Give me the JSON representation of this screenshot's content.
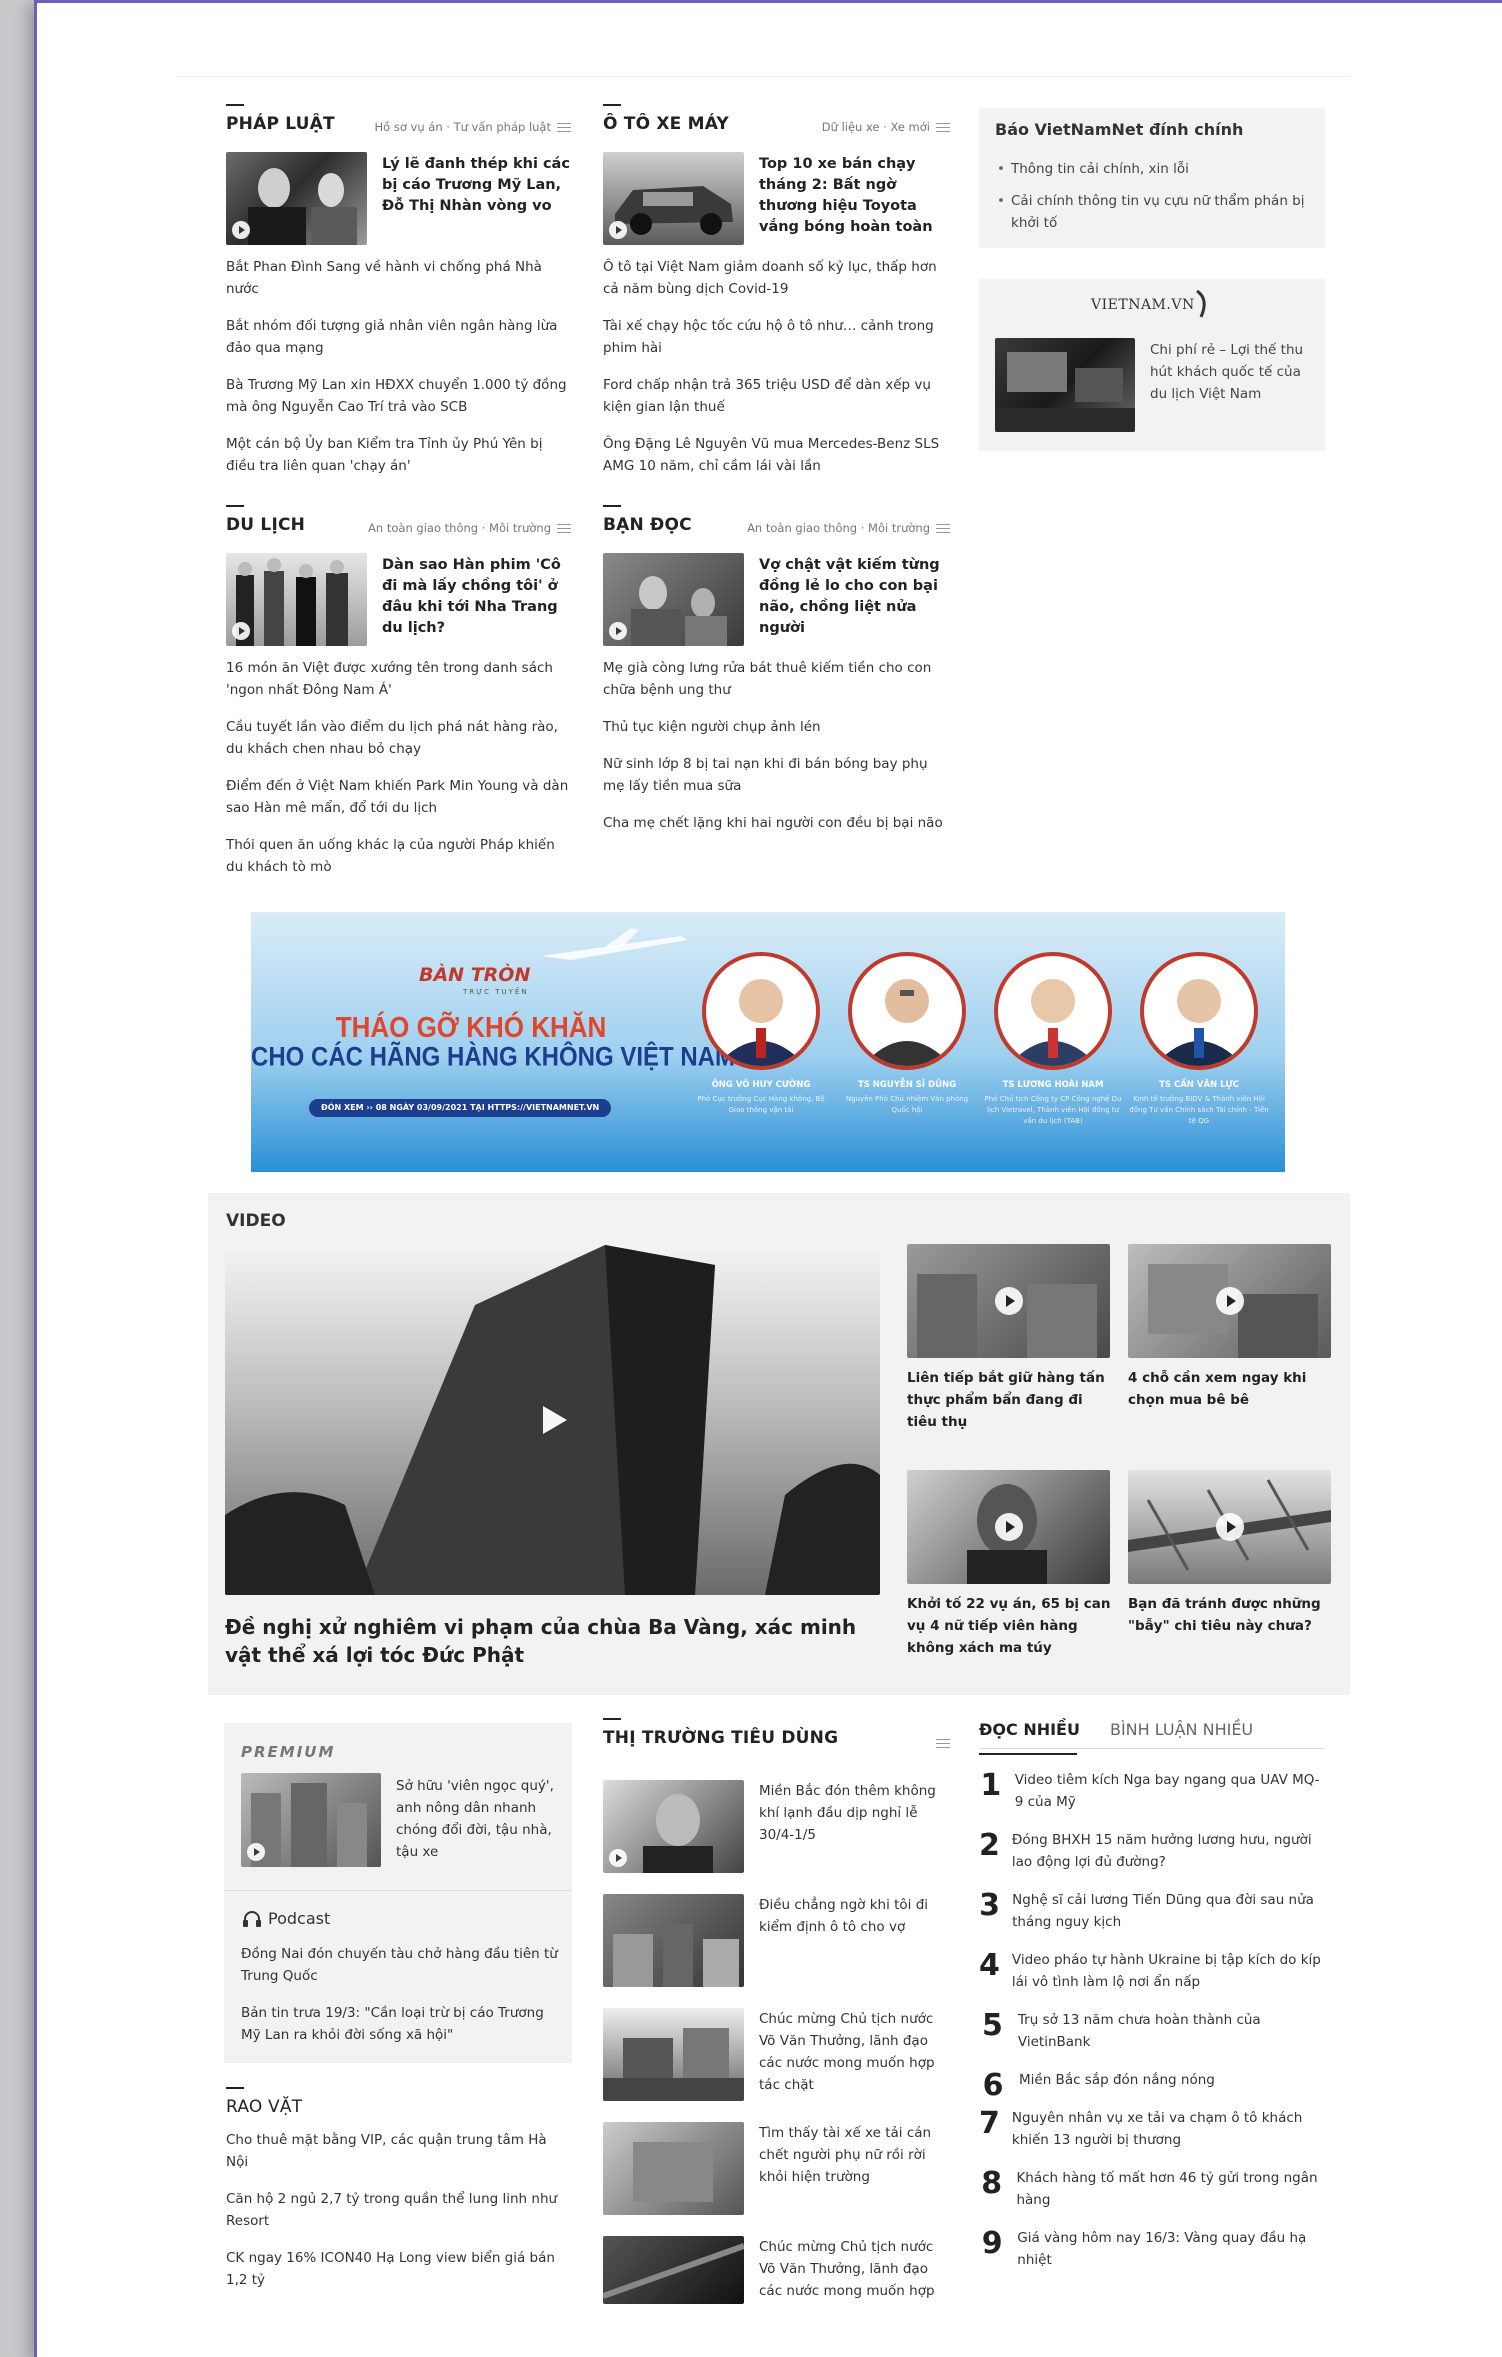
{
  "sections": {
    "phap_luat": {
      "title": "PHÁP LUẬT",
      "sub": "Hồ sơ vụ án · Tư vấn pháp luật",
      "lead": "Lý lẽ đanh thép khi các bị cáo Trương Mỹ Lan, Đỗ Thị Nhàn vòng vo",
      "items": [
        "Bắt Phan Đình Sang về hành vi chống phá Nhà nước",
        "Bắt nhóm đối tượng giả nhân viên ngân hàng lừa đảo qua mạng",
        "Bà Trương Mỹ Lan xin HĐXX chuyển 1.000 tỷ đồng mà ông Nguyễn Cao Trí trả vào SCB",
        "Một cán bộ Ủy ban Kiểm tra Tỉnh ủy Phú Yên bị điều tra liên quan 'chạy án'"
      ]
    },
    "oto": {
      "title": "Ô TÔ XE MÁY",
      "sub": "Dữ liệu xe · Xe mới",
      "lead": "Top 10 xe bán chạy tháng 2: Bất ngờ thương hiệu Toyota vắng bóng hoàn toàn",
      "items": [
        "Ô tô tại Việt Nam giảm doanh số kỷ lục, thấp hơn cả năm bùng dịch Covid-19",
        "Tài xế chạy hộc tốc cứu hộ ô tô như… cảnh trong phim hài",
        "Ford chấp nhận trả 365 triệu USD để dàn xếp vụ kiện gian lận thuế",
        "Ông Đặng Lê Nguyên Vũ mua Mercedes-Benz SLS AMG 10 năm, chỉ cầm lái vài lần"
      ]
    },
    "du_lich": {
      "title": "DU LỊCH",
      "sub": "An toàn giao thông · Môi trường",
      "lead": "Dàn sao Hàn phim 'Cô đi mà lấy chồng tôi' ở đâu khi tới Nha Trang du lịch?",
      "items": [
        "16 món ăn Việt được xướng tên trong danh sách 'ngon nhất Đông Nam Á'",
        "Cầu tuyết lần vào điểm du lịch phá nát hàng rào, du khách chen nhau bỏ chạy",
        "Điểm đến ở Việt Nam khiến Park Min Young và dàn sao Hàn mê mẩn, đổ tới du lịch",
        "Thói quen ăn uống khác lạ của người Pháp khiến du khách tò mò"
      ]
    },
    "ban_doc": {
      "title": "BẠN ĐỌC",
      "sub": "An toàn giao thông · Môi trường",
      "lead": "Vợ chật vật kiếm từng đồng lẻ lo cho con bại não, chồng liệt nửa người",
      "items": [
        "Mẹ già còng lưng rửa bát thuê kiếm tiền cho con chữa bệnh ung thư",
        "Thủ tục kiện người chụp ảnh lén",
        "Nữ sinh lớp 8 bị tai nạn khi đi bán bóng bay phụ mẹ lấy tiền mua sữa",
        "Cha mẹ chết lặng khi hai người con đều bị bại não"
      ]
    }
  },
  "correction": {
    "title": "Báo VietNamNet đính chính",
    "items": [
      "Thông tin cải chính, xin lỗi",
      "Cải chính thông tin vụ cựu nữ thẩm phán bị khởi tố"
    ]
  },
  "vietnamvn": {
    "logo": "VIETNAM.VN",
    "text": "Chi phí rẻ – Lợi thế thu hút khách quốc tế của du lịch Việt Nam"
  },
  "banner": {
    "brand": "BÀN TRÒN",
    "brand_sub": "TRỰC TUYẾN",
    "headline1": "THÁO GỠ KHÓ KHĂN",
    "headline2": "CHO CÁC HÃNG HÀNG KHÔNG VIỆT NAM",
    "cta": "ĐÓN XEM ››  08 NGÀY 03/09/2021 TẠI HTTPS://VIETNAMNET.VN",
    "speakers": [
      {
        "name": "ÔNG VÕ HUY CƯỜNG",
        "role": "Phó Cục trưởng Cục Hàng không, Bộ Giao thông vận tải"
      },
      {
        "name": "TS NGUYỄN SĨ DŨNG",
        "role": "Nguyên Phó Chủ nhiệm Văn phòng Quốc hội"
      },
      {
        "name": "TS LƯƠNG HOÀI NAM",
        "role": "Phó Chủ tịch Công ty CP Công nghệ Du lịch Vietravel, Thành viên Hội đồng tư vấn du lịch (TAB)"
      },
      {
        "name": "TS CẤN VĂN LỰC",
        "role": "Kinh tế trưởng BIDV & Thành viên Hội đồng Tư vấn Chính sách Tài chính - Tiền tệ QG"
      }
    ]
  },
  "video": {
    "label": "VIDEO",
    "main_title": "Đề nghị xử nghiêm vi phạm của chùa Ba Vàng, xác minh vật thể xá lợi tóc Đức Phật",
    "items": [
      "Liên tiếp bắt giữ hàng tấn thực phẩm bẩn đang đi tiêu thụ",
      "4 chỗ cần xem ngay khi chọn mua bê bê",
      "Khởi tố 22 vụ án, 65 bị can vụ 4 nữ tiếp viên hàng không xách ma túy",
      "Bạn đã tránh được những \"bẫy\" chi tiêu này chưa?"
    ]
  },
  "premium": {
    "label": "PREMIUM",
    "lead": "Sở hữu 'viên ngọc quý', anh nông dân nhanh chóng đổi đời, tậu nhà, tậu xe",
    "podcast_label": "Podcast",
    "podcast_items": [
      "Đồng Nai đón chuyến tàu chở hàng đầu tiên từ Trung Quốc",
      "Bản tin trưa 19/3: \"Cần loại trừ bị cáo Trương Mỹ Lan ra khỏi đời sống xã hội\""
    ]
  },
  "rao_vat": {
    "title": "RAO VẶT",
    "items": [
      "Cho thuê mặt bằng VIP, các quận trung tâm Hà Nội",
      "Căn hộ 2 ngủ 2,7 tỷ trong quần thể lung linh như Resort",
      "CK ngay 16% ICON40 Hạ Long view biển giá bán 1,2 tỷ"
    ]
  },
  "thi_truong": {
    "title": "THỊ TRƯỜNG TIÊU DÙNG",
    "items": [
      "Miền Bắc đón thêm không khí lạnh đầu dịp nghỉ lễ 30/4-1/5",
      "Điều chẳng ngờ khi tôi đi kiểm định ô tô cho vợ",
      "Chúc mừng Chủ tịch nước Võ Văn Thưởng, lãnh đạo các nước mong muốn hợp tác chặt",
      "Tìm thấy tài xế xe tải cán chết người phụ nữ rồi rời khỏi hiện trường",
      "Chúc mừng Chủ tịch nước Võ Văn Thưởng, lãnh đạo các nước mong muốn hợp"
    ]
  },
  "most_read": {
    "tab_active": "ĐỌC NHIỀU",
    "tab_other": "BÌNH LUẬN NHIỀU",
    "items": [
      {
        "n": "1",
        "t": "Video tiêm kích Nga bay ngang qua UAV MQ-9 của Mỹ"
      },
      {
        "n": "2",
        "t": "Đóng BHXH 15 năm hưởng lương hưu, người lao động lợi đủ đường?"
      },
      {
        "n": "3",
        "t": "Nghệ sĩ cải lương Tiến Dũng qua đời sau nửa tháng nguy kịch"
      },
      {
        "n": "4",
        "t": "Video pháo tự hành Ukraine bị tập kích do kíp lái vô tình làm lộ nơi ẩn nấp"
      },
      {
        "n": "5",
        "t": "Trụ sở 13 năm chưa hoàn thành của VietinBank"
      },
      {
        "n": "6",
        "t": "Miền Bắc sắp đón nắng nóng"
      },
      {
        "n": "7",
        "t": "Nguyên nhân vụ xe tải va chạm ô tô khách khiến 13 người bị thương"
      },
      {
        "n": "8",
        "t": "Khách hàng tố mất hơn 46 tỷ gửi trong ngân hàng"
      },
      {
        "n": "9",
        "t": "Giá vàng hôm nay 16/3: Vàng quay đầu hạ nhiệt"
      }
    ]
  }
}
